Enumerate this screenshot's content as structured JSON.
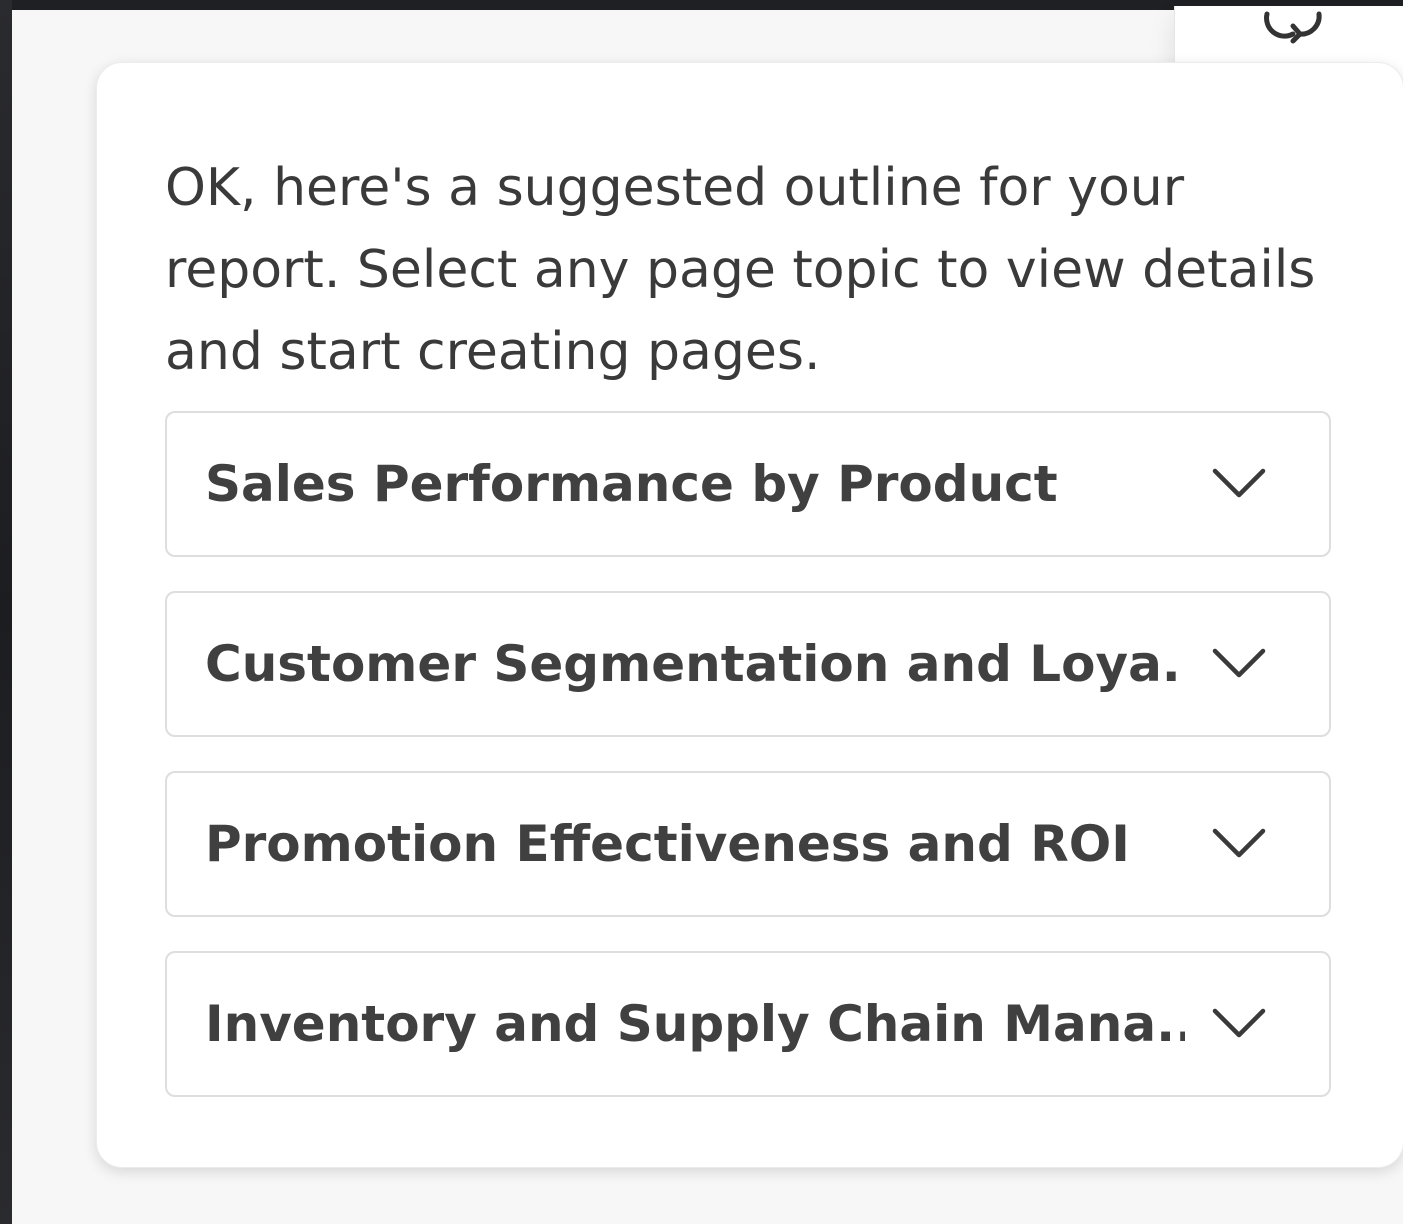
{
  "panel": {
    "intro_text": "OK, here's a suggested outline for your report. Select any page topic to view details and start creating pages."
  },
  "topics": [
    {
      "label": "Sales Performance by Product",
      "icon": "chevron-down-icon"
    },
    {
      "label": "Customer Segmentation and Loya...",
      "icon": "chevron-down-icon"
    },
    {
      "label": "Promotion Effectiveness and ROI",
      "icon": "chevron-down-icon"
    },
    {
      "label": "Inventory and Supply Chain Mana...",
      "icon": "chevron-down-icon"
    }
  ],
  "corner_button": {
    "icon": "refresh-icon"
  },
  "colors": {
    "panel_background": "#f7f7f7",
    "card_background": "#ffffff",
    "text": "#3a3a3a",
    "border": "#dedede"
  }
}
